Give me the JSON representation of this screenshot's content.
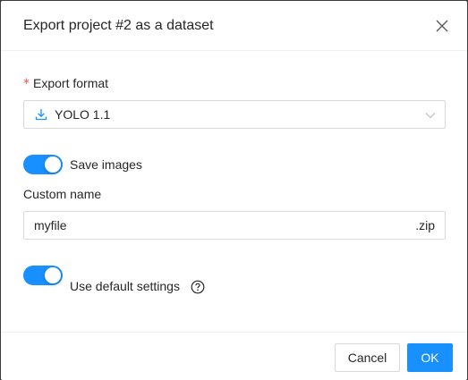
{
  "dialog": {
    "title": "Export project #2 as a dataset",
    "close_icon": "close-icon"
  },
  "export_format": {
    "required_mark": "*",
    "label": "Export format",
    "selected_value": "YOLO 1.1",
    "value_icon": "download-icon",
    "arrow_icon": "chevron-down-icon"
  },
  "save_images": {
    "label": "Save images",
    "enabled": true
  },
  "custom_name": {
    "label": "Custom name",
    "value": "myfile",
    "suffix": ".zip"
  },
  "use_default_settings": {
    "label": "Use default settings",
    "enabled": true,
    "help_icon": "question-circle-icon"
  },
  "footer": {
    "cancel_label": "Cancel",
    "ok_label": "OK"
  },
  "colors": {
    "accent": "#1890ff",
    "required": "#ff4d4f",
    "border": "#d9d9d9",
    "text": "#262626"
  }
}
